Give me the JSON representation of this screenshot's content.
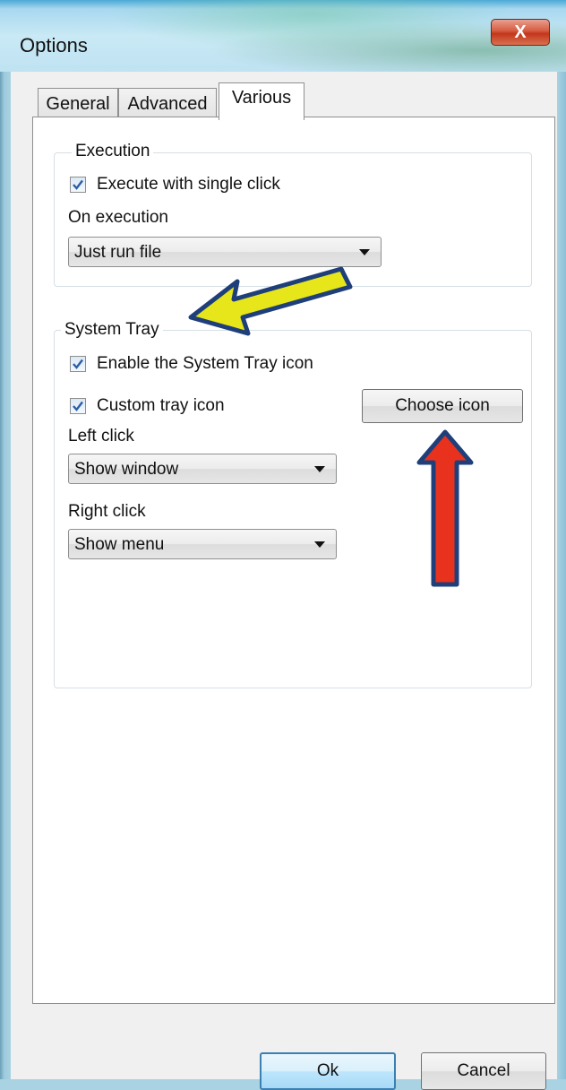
{
  "window": {
    "title": "Options",
    "close_glyph": "X"
  },
  "tabs": [
    {
      "label": "General",
      "active": false
    },
    {
      "label": "Advanced",
      "active": false
    },
    {
      "label": "Various",
      "active": true
    }
  ],
  "execution": {
    "group_label": "Execution",
    "single_click": {
      "label": "Execute with single click",
      "checked": true
    },
    "on_execution_label": "On execution",
    "on_execution_value": "Just run file"
  },
  "system_tray": {
    "group_label": "System Tray",
    "enable_icon": {
      "label": "Enable the System Tray icon",
      "checked": true
    },
    "custom_icon": {
      "label": "Custom tray icon",
      "checked": true
    },
    "choose_icon_label": "Choose icon",
    "left_click_label": "Left click",
    "left_click_value": "Show window",
    "right_click_label": "Right click",
    "right_click_value": "Show menu"
  },
  "footer": {
    "ok_label": "Ok",
    "cancel_label": "Cancel"
  },
  "colors": {
    "yellow_arrow": "#e6e61a",
    "red_arrow": "#e8321e",
    "arrow_outline": "#1f3f7a"
  }
}
